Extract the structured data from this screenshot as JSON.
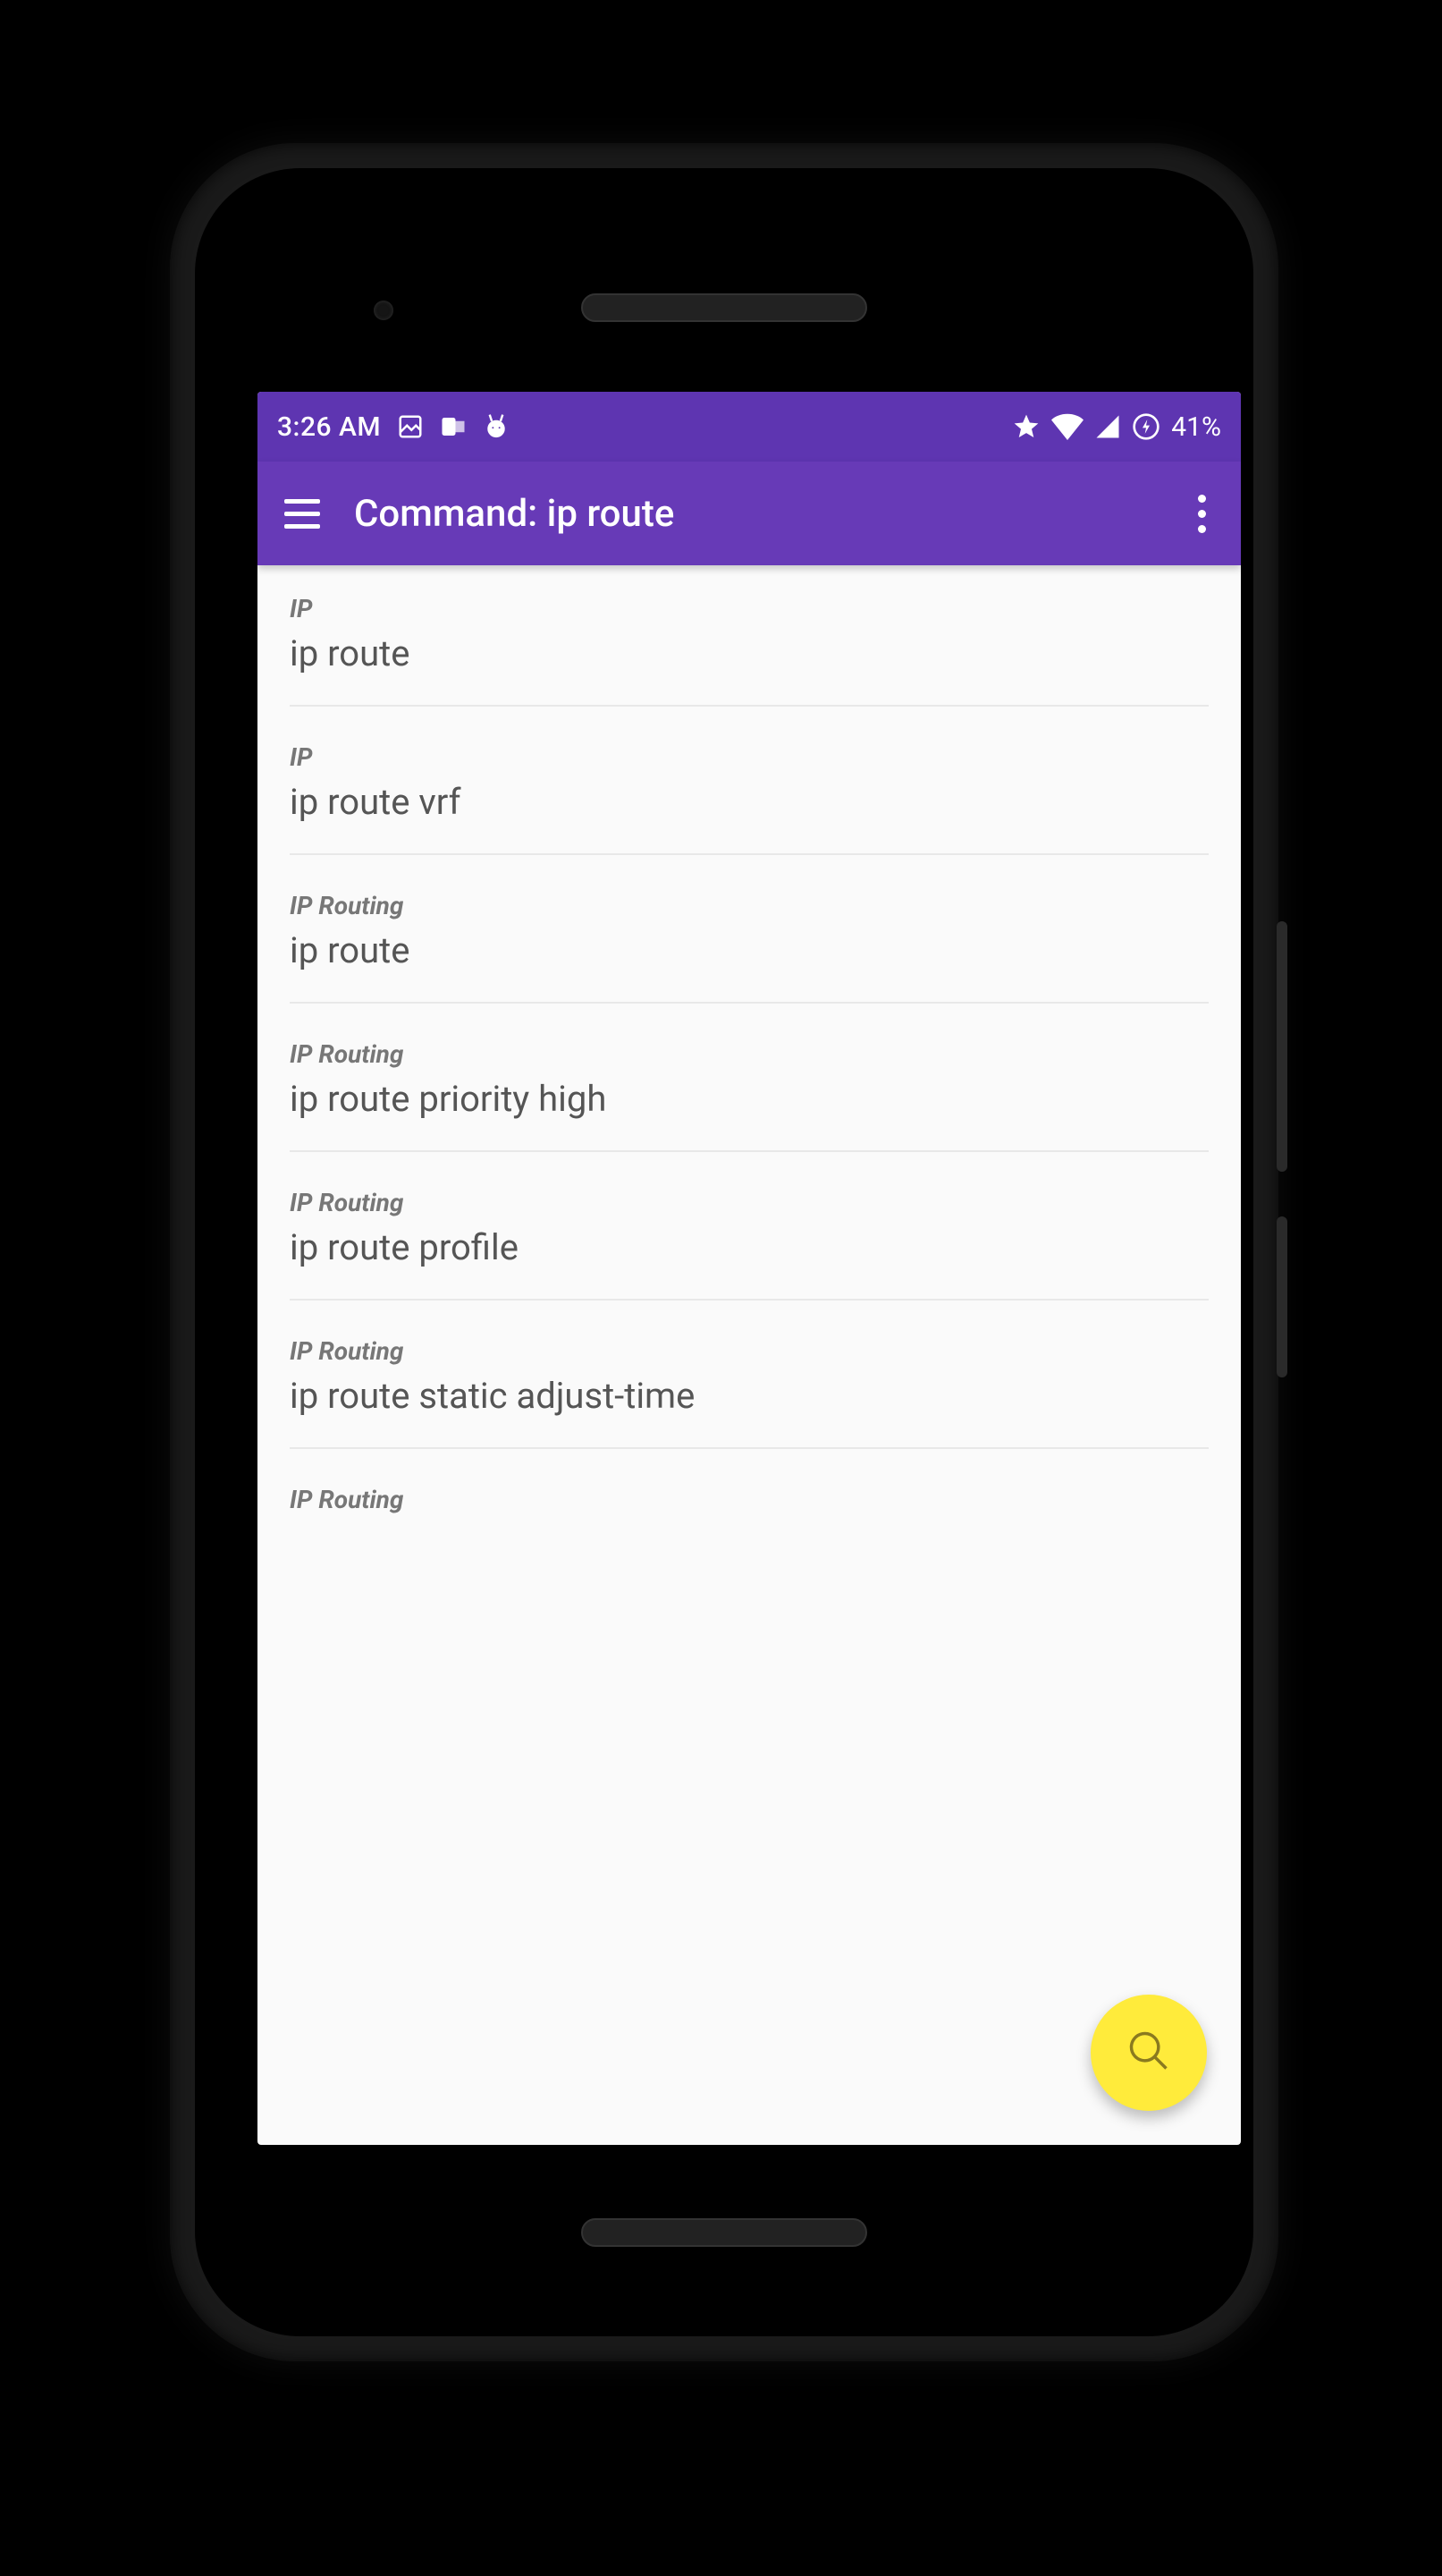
{
  "status_bar": {
    "time": "3:26 AM",
    "battery_pct": "41%"
  },
  "app_bar": {
    "title": "Command: ip route"
  },
  "list": {
    "items": [
      {
        "category": "IP",
        "title": "ip route"
      },
      {
        "category": "IP",
        "title": "ip route vrf"
      },
      {
        "category": "IP Routing",
        "title": "ip route"
      },
      {
        "category": "IP Routing",
        "title": "ip route priority high"
      },
      {
        "category": "IP Routing",
        "title": "ip route profile"
      },
      {
        "category": "IP Routing",
        "title": "ip route static adjust-time"
      },
      {
        "category": "IP Routing",
        "title": ""
      }
    ]
  }
}
